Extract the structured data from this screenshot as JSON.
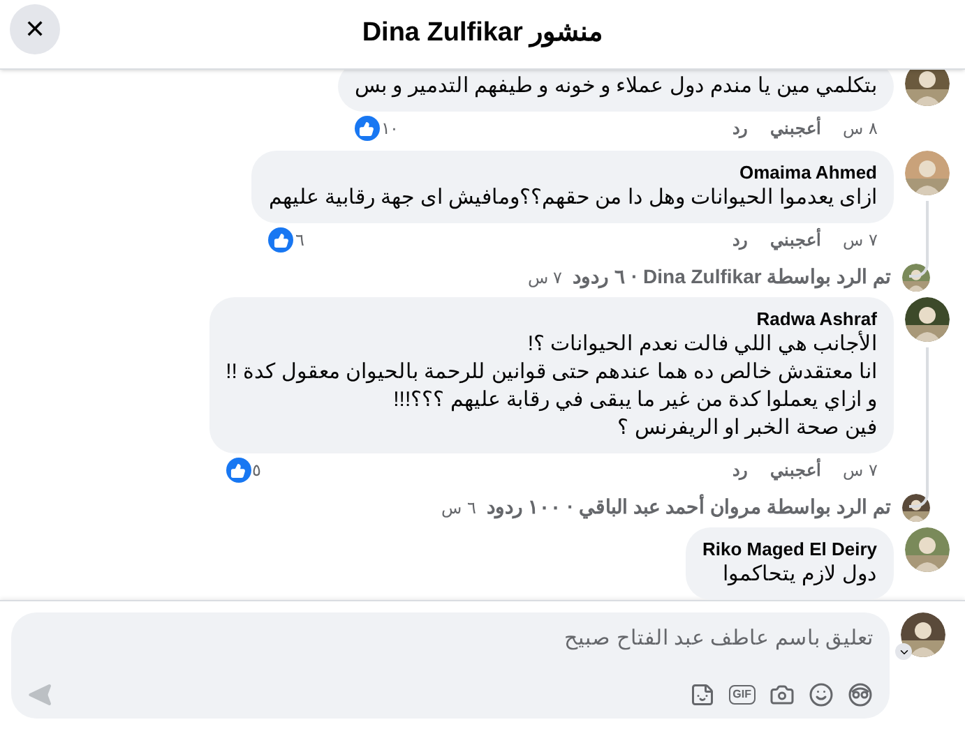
{
  "header": {
    "title": "منشور Dina Zulfikar",
    "close": "✕"
  },
  "comments": [
    {
      "lines": [
        "بتكلمي مين يا مندم دول عملاء و خونه و طيفهم التدمير و بس"
      ],
      "time": "٨ س",
      "like": "أعجبني",
      "reply": "رد",
      "reactions": "١٠"
    },
    {
      "author": "Omaima Ahmed",
      "lines": [
        "ازاى يعدموا الحيوانات وهل دا من حقهم؟؟ومافيش اى جهة رقابية عليهم"
      ],
      "time": "٧ س",
      "like": "أعجبني",
      "reply": "رد",
      "reactions": "٦",
      "replies": {
        "text": "تم الرد بواسطة Dina Zulfikar · ٦ ردود",
        "age": "٧ س"
      }
    },
    {
      "author": "Radwa Ashraf",
      "lines": [
        "الأجانب هي اللي فالت نعدم الحيوانات ؟!",
        "انا معتقدش خالص ده هما عندهم حتى قوانين للرحمة بالحيوان معقول كدة !!",
        "و ازاي يعملوا كدة من غير ما يبقى في رقابة عليهم ؟؟؟!!!",
        "فين صحة الخبر او الريفرنس ؟"
      ],
      "time": "٧ س",
      "like": "أعجبني",
      "reply": "رد",
      "reactions": "٥",
      "replies": {
        "text": "تم الرد بواسطة مروان أحمد عبد الباقي · ١٠٠ ردود",
        "age": "٦ س"
      }
    },
    {
      "author": "Riko Maged El Deiry",
      "lines": [
        "دول لازم يتحاكموا"
      ]
    }
  ],
  "composer": {
    "placeholder": "تعليق باسم عاطف عبد الفتاح صبيح",
    "tools": [
      {
        "kind": "avatar"
      },
      {
        "kind": "emoji"
      },
      {
        "kind": "camera"
      },
      {
        "kind": "gif",
        "label": "GIF"
      },
      {
        "kind": "sticker"
      }
    ]
  }
}
